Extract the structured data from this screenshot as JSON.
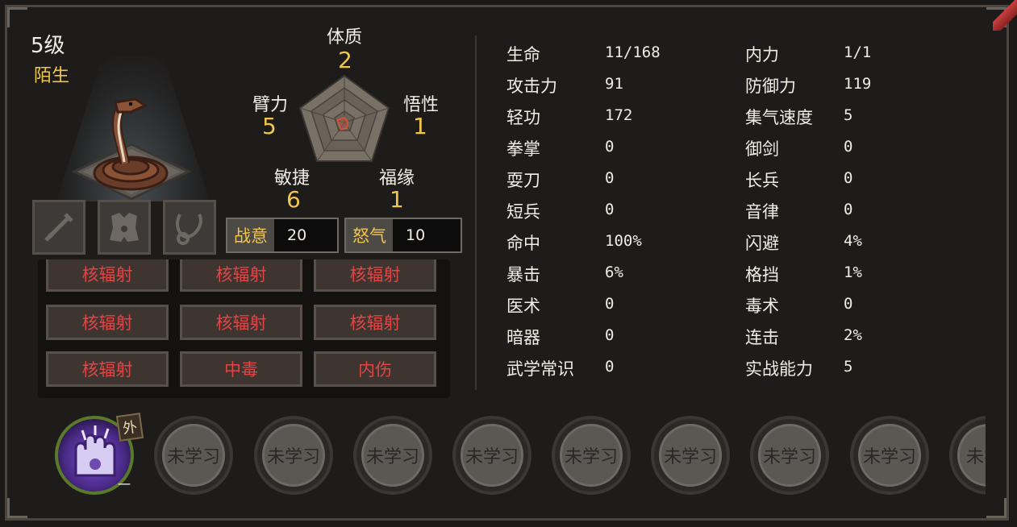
{
  "header": {
    "level": "5级",
    "relation": "陌生"
  },
  "attributes": {
    "tizhi": {
      "name": "体质",
      "value": "2"
    },
    "wuxing": {
      "name": "悟性",
      "value": "1"
    },
    "fuyuan": {
      "name": "福缘",
      "value": "1"
    },
    "minjie": {
      "name": "敏捷",
      "value": "6"
    },
    "biliu": {
      "name": "臂力",
      "value": "5"
    }
  },
  "combat": {
    "zhanyi_label": "战意",
    "zhanyi_value": "20",
    "nuqi_label": "怒气",
    "nuqi_value": "10"
  },
  "statuses": [
    "核辐射",
    "核辐射",
    "核辐射",
    "核辐射",
    "核辐射",
    "核辐射",
    "核辐射",
    "中毒",
    "内伤"
  ],
  "stats_left": [
    {
      "name": "生命",
      "value": "11/168"
    },
    {
      "name": "攻击力",
      "value": "91"
    },
    {
      "name": "轻功",
      "value": "172"
    },
    {
      "name": "拳掌",
      "value": "0"
    },
    {
      "name": "耍刀",
      "value": "0"
    },
    {
      "name": "短兵",
      "value": "0"
    },
    {
      "name": "命中",
      "value": "100%"
    },
    {
      "name": "暴击",
      "value": "6%"
    },
    {
      "name": "医术",
      "value": "0"
    },
    {
      "name": "暗器",
      "value": "0"
    },
    {
      "name": "武学常识",
      "value": "0"
    }
  ],
  "stats_right": [
    {
      "name": "内力",
      "value": "1/1"
    },
    {
      "name": "防御力",
      "value": "119"
    },
    {
      "name": "集气速度",
      "value": "5"
    },
    {
      "name": "御剑",
      "value": "0"
    },
    {
      "name": "长兵",
      "value": "0"
    },
    {
      "name": "音律",
      "value": "0"
    },
    {
      "name": "闪避",
      "value": "4%"
    },
    {
      "name": "格挡",
      "value": "1%"
    },
    {
      "name": "毒术",
      "value": "0"
    },
    {
      "name": "连击",
      "value": "2%"
    },
    {
      "name": "实战能力",
      "value": "5"
    }
  ],
  "skills": {
    "active_badge": "外",
    "active_level": "一",
    "unlearned_label": "未学习",
    "unlearned_truncated": "未学"
  },
  "icons": {
    "portrait": "coiled-snake-icon",
    "equip": [
      "sword-icon",
      "armor-icon",
      "necklace-icon"
    ],
    "active_skill": "purple-claw-icon"
  },
  "colors": {
    "gold": "#f0c54a",
    "status_red": "#e04646",
    "bg": "#1c1a19"
  }
}
